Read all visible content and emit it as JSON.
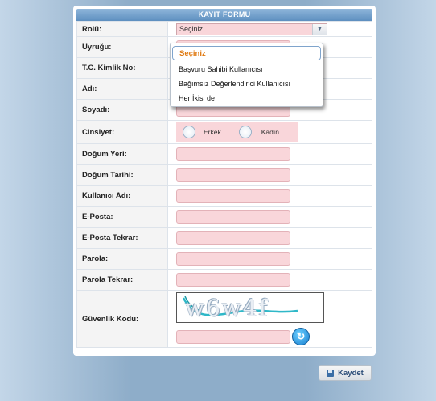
{
  "form": {
    "title": "KAYIT FORMU",
    "labels": {
      "role": "Rolü:",
      "nationality": "Uyruğu:",
      "tc_id": "T.C. Kimlik No:",
      "first_name": "Adı:",
      "last_name": "Soyadı:",
      "gender": "Cinsiyet:",
      "birth_place": "Doğum Yeri:",
      "birth_date": "Doğum Tarihi:",
      "username": "Kullanıcı Adı:",
      "email": "E-Posta:",
      "email_repeat": "E-Posta Tekrar:",
      "password": "Parola:",
      "password_repeat": "Parola Tekrar:",
      "captcha": "Güvenlik Kodu:"
    },
    "role_select": {
      "selected": "Seçiniz",
      "arrow_icon": "chevron-down-icon"
    },
    "gender_options": [
      "Erkek",
      "Kadın"
    ],
    "captcha_text": "w6w4f",
    "refresh_icon": "refresh-icon"
  },
  "dropdown": {
    "options": [
      "Seçiniz",
      "Başvuru Sahibi Kullanıcısı",
      "Bağımsız Değerlendirici Kullanıcısı",
      "Her İkisi de"
    ]
  },
  "actions": {
    "save_label": "Kaydet",
    "save_icon": "save-icon"
  },
  "colors": {
    "input_bg": "#f9d6da",
    "header": "#6f9cc9",
    "selected_option": "#e07a12",
    "background": "#8eadc9"
  }
}
